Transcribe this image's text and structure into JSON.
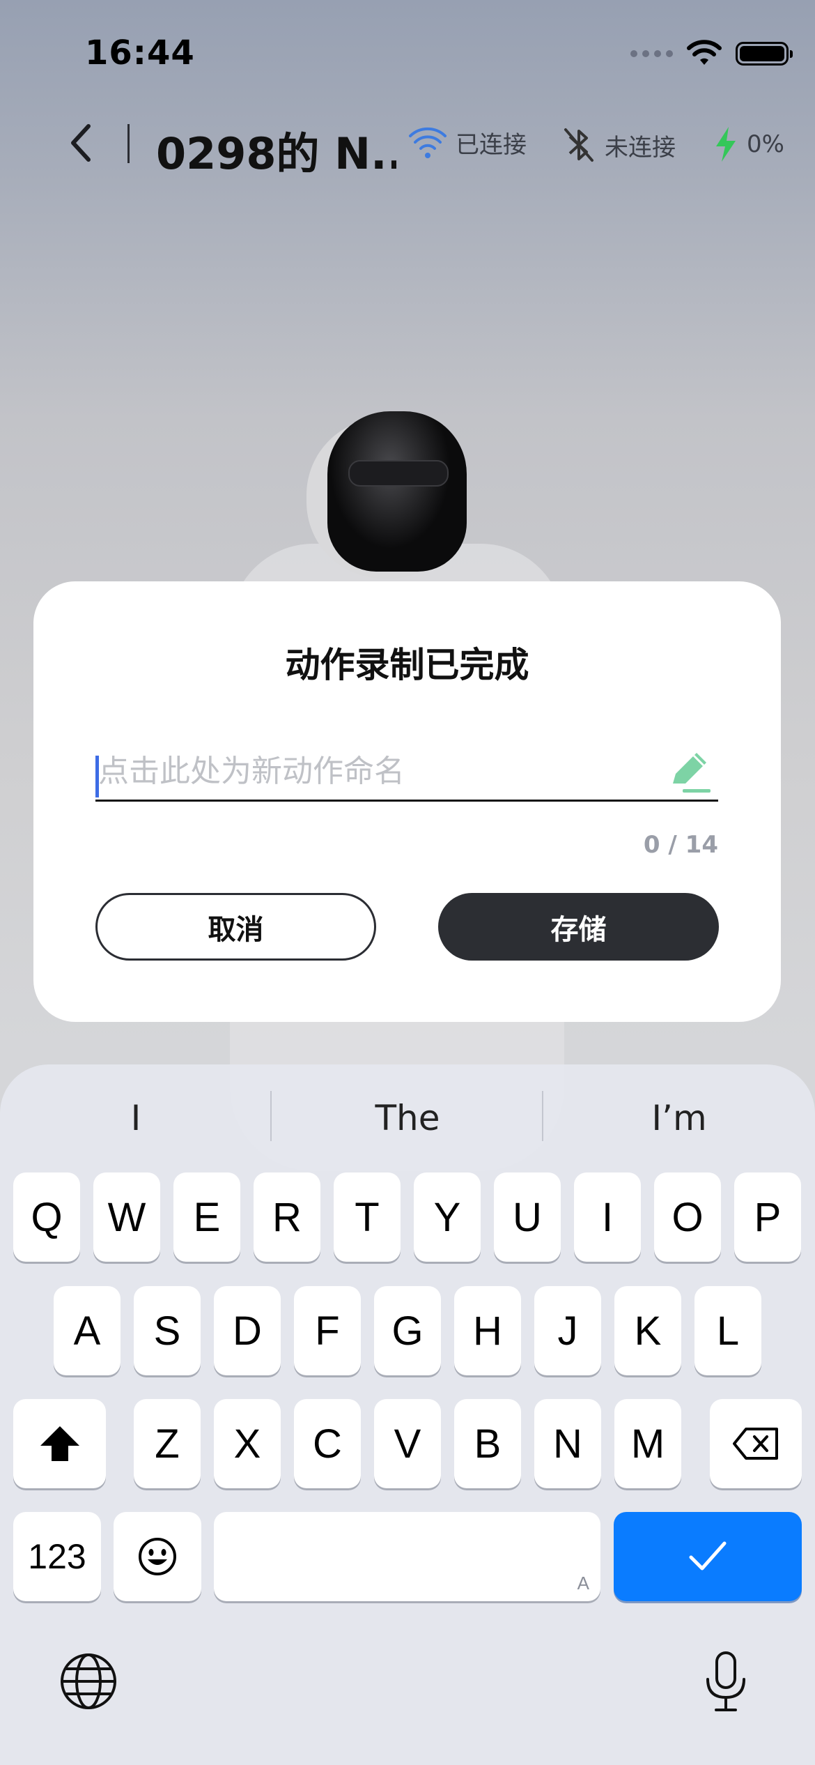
{
  "status_bar": {
    "time": "16:44"
  },
  "nav": {
    "title": "0298的 N...",
    "wifi_status": "已连接",
    "bluetooth_status": "未连接",
    "battery_status": "0%"
  },
  "dialog": {
    "title": "动作录制已完成",
    "input_value": "",
    "input_placeholder": "点击此处为新动作命名",
    "counter": "0 / 14",
    "cancel_label": "取消",
    "save_label": "存储"
  },
  "keyboard": {
    "suggestions": [
      "I",
      "The",
      "I’m"
    ],
    "row1": [
      "Q",
      "W",
      "E",
      "R",
      "T",
      "Y",
      "U",
      "I",
      "O",
      "P"
    ],
    "row2": [
      "A",
      "S",
      "D",
      "F",
      "G",
      "H",
      "J",
      "K",
      "L"
    ],
    "row3": [
      "Z",
      "X",
      "C",
      "V",
      "B",
      "N",
      "M"
    ],
    "numbers_label": "123",
    "space_hint": "A"
  },
  "colors": {
    "accent_blue": "#0a7cff",
    "charge_green": "#34c759",
    "wifi_blue": "#3d7be0",
    "pencil_green": "#7dd3a5"
  }
}
